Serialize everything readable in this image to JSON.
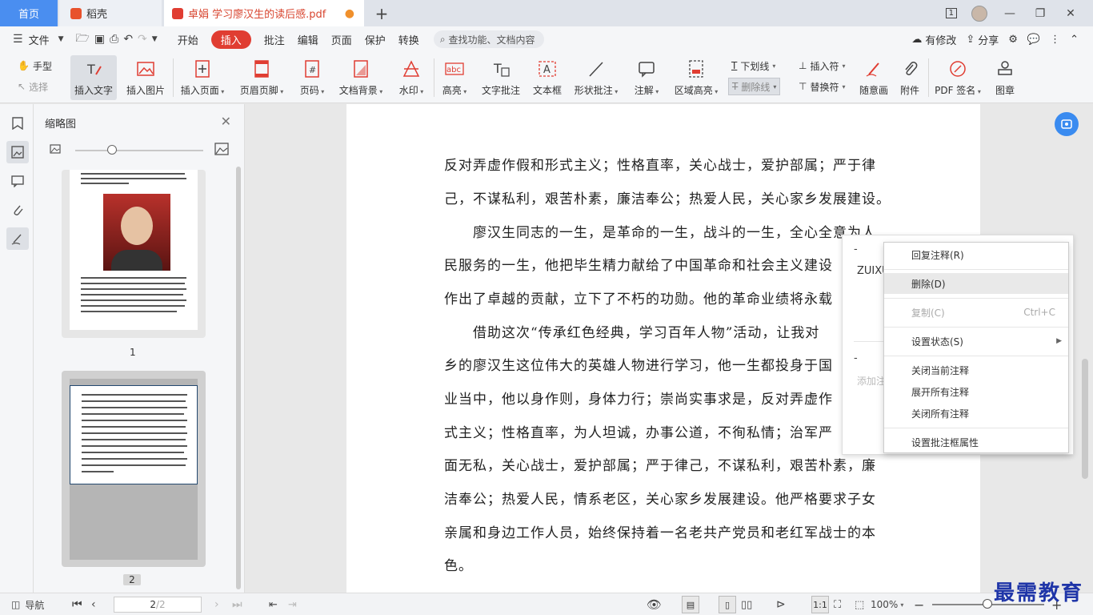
{
  "tabs": {
    "home": "首页",
    "wps": "稻壳",
    "doc": "卓娟 学习廖汉生的读后感.pdf",
    "add": "+"
  },
  "window": {
    "page_badge": "1"
  },
  "menu": {
    "file": "文件",
    "items": [
      "开始",
      "插入",
      "批注",
      "编辑",
      "页面",
      "保护",
      "转换"
    ],
    "active": "插入",
    "search_placeholder": "查找功能、文档内容",
    "modified": "有修改",
    "share": "分享"
  },
  "toolbar": {
    "hand": "手型",
    "select": "选择",
    "insert_text": "插入文字",
    "insert_image": "插入图片",
    "insert_page": "插入页面",
    "header_footer": "页眉页脚",
    "page_number": "页码",
    "doc_background": "文档背景",
    "watermark": "水印",
    "highlight": "高亮",
    "text_annotation": "文字批注",
    "text_box": "文本框",
    "shape_annotation": "形状批注",
    "annotate": "注解",
    "area_highlight": "区域高亮",
    "underline": "下划线",
    "strikethrough": "删除线",
    "insert_mark": "插入符",
    "replace_mark": "替换符",
    "freehand": "随意画",
    "attachment": "附件",
    "pdf_sign": "PDF 签名",
    "stamp": "图章",
    "text_icon_abc": "abc"
  },
  "thumbnails": {
    "title": "缩略图",
    "pages": [
      "1",
      "2"
    ]
  },
  "document": {
    "lines": [
      "反对弄虚作假和形式主义；性格直率，关心战士，爱护部属；严于律",
      "己，不谋私利，艰苦朴素，廉洁奉公；热爱人民，关心家乡发展建设。",
      "廖汉生同志的一生，是革命的一生，战斗的一生，全心全意为人",
      "民服务的一生，他把毕生精力献给了中国革命和社会主义建设",
      "作出了卓越的贡献，立下了不朽的功勋。他的革命业绩将永载",
      "借助这次“传承红色经典，学习百年人物”活动，让我对",
      "乡的廖汉生这位伟大的英雄人物进行学习，他一生都投身于国",
      "业当中，他以身作则，身体力行；崇尚实事求是，反对弄虚作",
      "式主义；性格直率，为人坦诚，办事公道，不徇私情；治军严",
      "面无私，关心战士，爱护部属；严于律己，不谋私利，艰苦朴素，廉",
      "洁奉公；热爱人民，情系老区，关心家乡发展建设。他严格要求子女",
      "亲属和身边工作人员，始终保持着一名老共产党员和老红军战士的本",
      "色。"
    ]
  },
  "annotation": {
    "dash1": "-",
    "user": "ZUIXU",
    "dash2": "-",
    "add_placeholder": "添加注"
  },
  "context_menu": {
    "reply": "回复注释(R)",
    "delete": "删除(D)",
    "copy": "复制(C)",
    "copy_shortcut": "Ctrl+C",
    "set_status": "设置状态(S)",
    "close_current": "关闭当前注释",
    "expand_all": "展开所有注释",
    "close_all": "关闭所有注释",
    "set_properties": "设置批注框属性"
  },
  "status": {
    "nav": "导航",
    "page_current": "2",
    "page_total": "/2",
    "zoom": "100%",
    "single_page": "1:1"
  },
  "watermark": "最需教育"
}
